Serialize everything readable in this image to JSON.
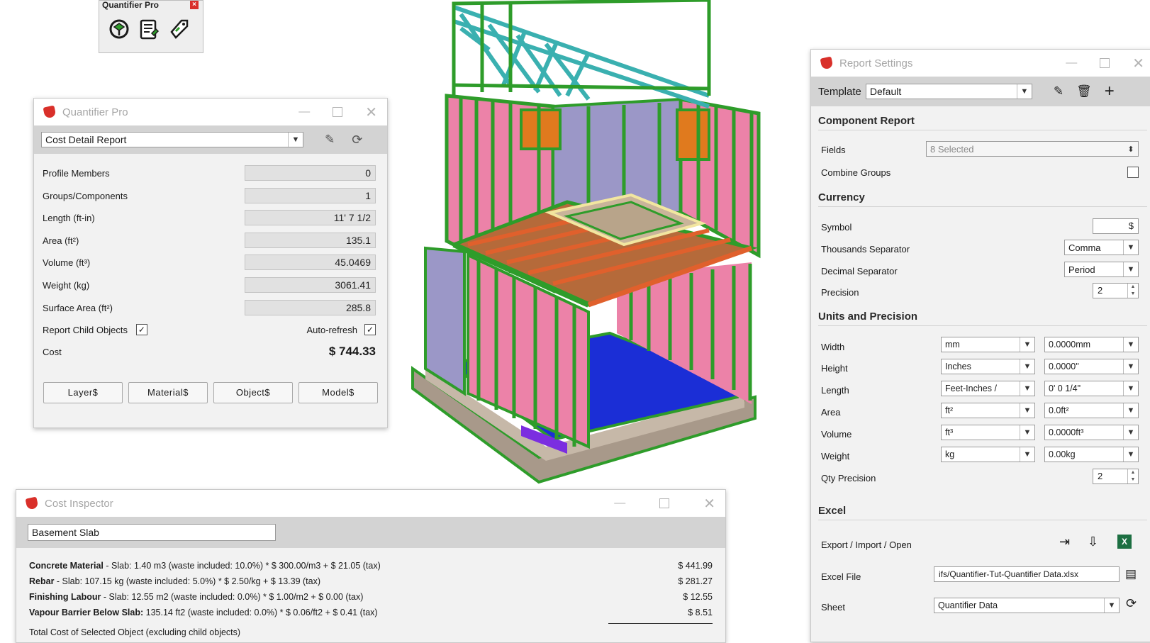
{
  "toolbar_mini": {
    "title": "Quantifier Pro",
    "icons": [
      "model-component-icon",
      "report-list-icon",
      "price-tag-icon"
    ]
  },
  "quantifier": {
    "title": "Quantifier Pro",
    "report_type": "Cost Detail Report",
    "rows": [
      {
        "label": "Profile Members",
        "value": "0"
      },
      {
        "label": "Groups/Components",
        "value": "1"
      },
      {
        "label": "Length (ft-in)",
        "value": "11' 7 1/2"
      },
      {
        "label": "Area (ft²)",
        "value": "135.1"
      },
      {
        "label": "Volume (ft³)",
        "value": "45.0469"
      },
      {
        "label": "Weight (kg)",
        "value": "3061.41"
      },
      {
        "label": "Surface Area (ft²)",
        "value": "285.8"
      }
    ],
    "report_child_label": "Report Child Objects",
    "auto_refresh_label": "Auto-refresh",
    "cost_label": "Cost",
    "cost_value": "$ 744.33",
    "buttons": [
      "Layer$",
      "Material$",
      "Object$",
      "Model$"
    ]
  },
  "report_settings": {
    "title": "Report Settings",
    "template_label": "Template",
    "template_value": "Default",
    "sections": {
      "component": "Component Report",
      "currency": "Currency",
      "units": "Units and Precision",
      "excel": "Excel"
    },
    "fields_label": "Fields",
    "fields_value": "8 Selected",
    "combine_label": "Combine Groups",
    "symbol_label": "Symbol",
    "symbol_value": "$",
    "thousands_label": "Thousands Separator",
    "thousands_value": "Comma",
    "decimal_label": "Decimal Separator",
    "decimal_value": "Period",
    "precision_label": "Precision",
    "precision_value": "2",
    "units": [
      {
        "label": "Width",
        "unit": "mm",
        "format": "0.0000mm"
      },
      {
        "label": "Height",
        "unit": "Inches",
        "format": "0.0000\""
      },
      {
        "label": "Length",
        "unit": "Feet-Inches /",
        "format": "0' 0 1/4\""
      },
      {
        "label": "Area",
        "unit": "ft²",
        "format": "0.0ft²"
      },
      {
        "label": "Volume",
        "unit": "ft³",
        "format": "0.0000ft³"
      },
      {
        "label": "Weight",
        "unit": "kg",
        "format": "0.00kg"
      }
    ],
    "qty_label": "Qty Precision",
    "qty_value": "2",
    "export_label": "Export / Import / Open",
    "excel_file_label": "Excel File",
    "excel_file_value": "ifs/Quantifier-Tut-Quantifier Data.xlsx",
    "sheet_label": "Sheet",
    "sheet_value": "Quantifier Data"
  },
  "cost_inspector": {
    "title": "Cost Inspector",
    "object_name": "Basement Slab",
    "lines": [
      {
        "bold": "Concrete Material",
        "text": " - Slab: 1.40 m3 (waste included: 10.0%) * $ 300.00/m3 + $ 21.05 (tax)",
        "amount": "$ 441.99"
      },
      {
        "bold": "Rebar",
        "text": " - Slab: 107.15 kg (waste included: 5.0%) * $ 2.50/kg + $ 13.39 (tax)",
        "amount": "$ 281.27"
      },
      {
        "bold": "Finishing Labour",
        "text": " - Slab: 12.55 m2 (waste included: 0.0%) * $ 1.00/m2 + $ 0.00 (tax)",
        "amount": "$ 12.55"
      },
      {
        "bold": "Vapour Barrier Below Slab:",
        "text": " 135.14 ft2 (waste included: 0.0%) * $ 0.06/ft2 + $ 0.41 (tax)",
        "amount": "$ 8.51"
      }
    ],
    "total_label": "Total Cost of Selected Object (excluding child objects)"
  },
  "colors": {
    "stud_green": "#2e9c2a",
    "wall_pink": "#ec82a8",
    "floor_blue": "#1b2ed6",
    "joist_orange": "#e0602c",
    "teal_truss": "#3ab0b0"
  }
}
